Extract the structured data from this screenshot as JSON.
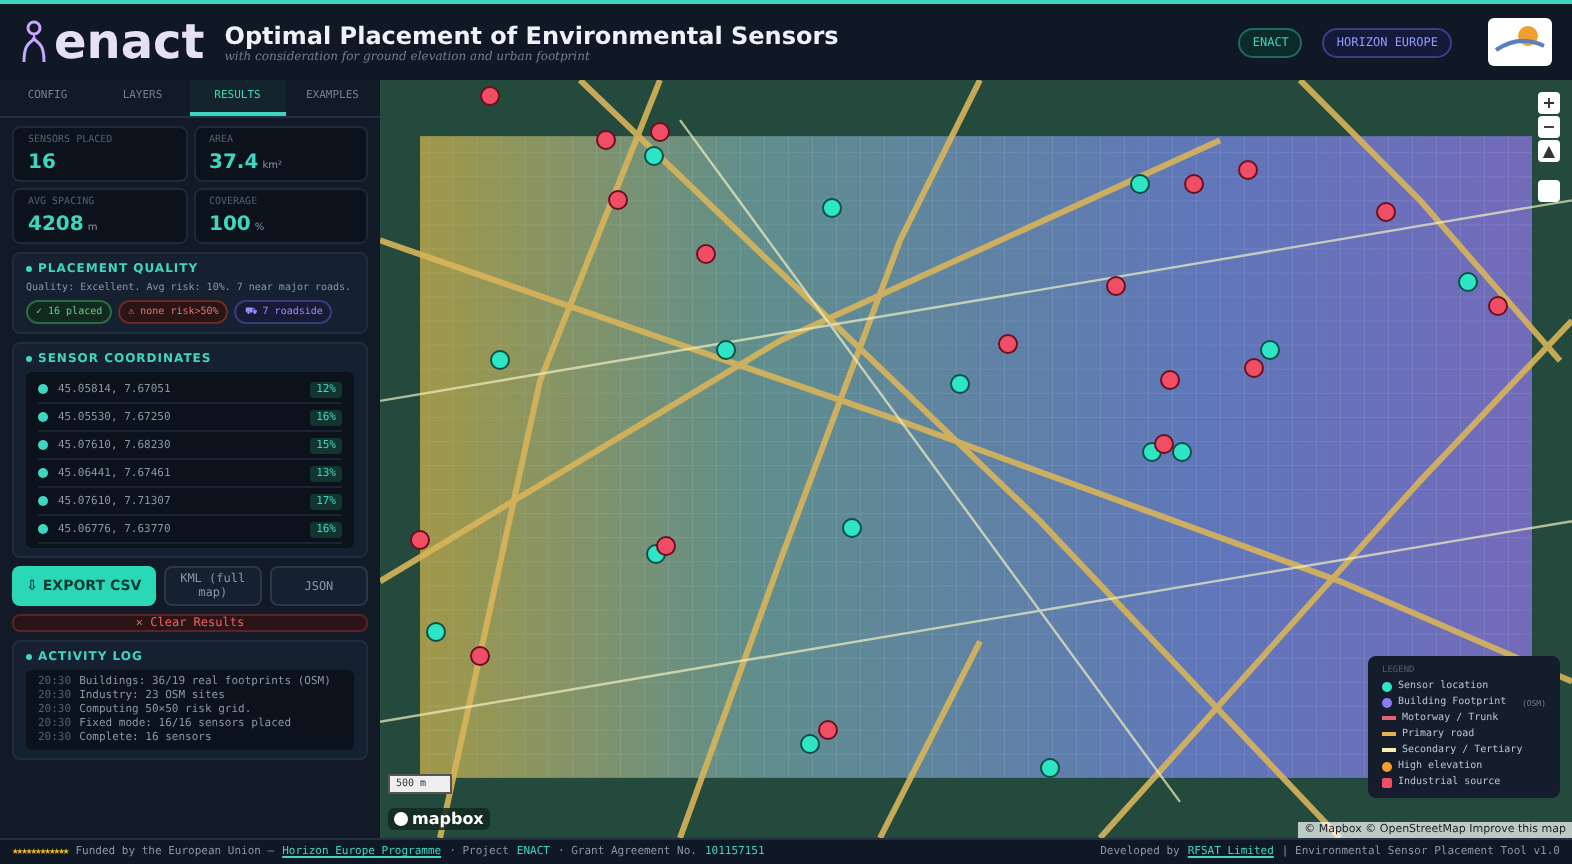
{
  "header": {
    "logo": "enact",
    "title": "Optimal Placement of Environmental Sensors",
    "subtitle": "with consideration for ground elevation and urban footprint",
    "badges": [
      "ENACT",
      "HORIZON EUROPE"
    ]
  },
  "tabs": [
    {
      "label": "CONFIG",
      "selected": false
    },
    {
      "label": "LAYERS",
      "selected": false
    },
    {
      "label": "RESULTS",
      "selected": true
    },
    {
      "label": "EXAMPLES",
      "selected": false
    }
  ],
  "stats": [
    {
      "label": "SENSORS PLACED",
      "value": "16"
    },
    {
      "label": "AREA",
      "value": "37.4",
      "unit": "km²"
    },
    {
      "label": "AVG SPACING",
      "value": "4208",
      "unit": "m"
    },
    {
      "label": "COVERAGE",
      "value": "100",
      "unit": "%"
    }
  ],
  "quality": {
    "title": "PLACEMENT QUALITY",
    "text": "Quality: Excellent. Avg risk: 10%. 7 near major roads.",
    "chips": [
      {
        "label": "✓ 16 placed",
        "kind": "good"
      },
      {
        "label": "⚠ none risk>50%",
        "kind": "warn"
      },
      {
        "label": "⛟ 7 roadside",
        "kind": "info"
      }
    ]
  },
  "coordinates": {
    "title": "SENSOR COORDINATES",
    "rows": [
      {
        "coords": "45.05814, 7.67051",
        "risk": "12%"
      },
      {
        "coords": "45.05530, 7.67250",
        "risk": "16%"
      },
      {
        "coords": "45.07610, 7.68230",
        "risk": "15%"
      },
      {
        "coords": "45.06441, 7.67461",
        "risk": "13%"
      },
      {
        "coords": "45.07610, 7.71307",
        "risk": "17%"
      },
      {
        "coords": "45.06776, 7.63770",
        "risk": "16%"
      }
    ]
  },
  "actions": [
    {
      "label": "⇩ EXPORT CSV",
      "kind": "primary"
    },
    {
      "label": "KML (full map)",
      "kind": "secondary"
    },
    {
      "label": "JSON",
      "kind": "secondary"
    },
    {
      "label": "✕ Clear Results",
      "kind": "danger"
    }
  ],
  "log": {
    "title": "ACTIVITY LOG",
    "lines": [
      {
        "time": "20:30",
        "text": "Buildings: 36/19 real footprints (OSM)"
      },
      {
        "time": "20:30",
        "text": "Industry: 23 OSM sites"
      },
      {
        "time": "20:30",
        "text": "Computing 50×50 risk grid."
      },
      {
        "time": "20:30",
        "text": "Fixed mode: 16/16 sensors placed"
      },
      {
        "time": "20:30",
        "text": "Complete: 16 sensors"
      }
    ]
  },
  "map": {
    "zoom_controls": [
      "+",
      "−",
      "▲"
    ],
    "scale": "500 m",
    "brand": "mapbox",
    "attribution": "© Mapbox © OpenStreetMap Improve this map",
    "markers": [
      {
        "kind": "sensor"
      },
      {
        "kind": "sensor"
      },
      {
        "kind": "sensor"
      },
      {
        "kind": "sensor"
      },
      {
        "kind": "sensor"
      },
      {
        "kind": "sensor"
      },
      {
        "kind": "sensor"
      },
      {
        "kind": "sensor"
      },
      {
        "kind": "sensor"
      },
      {
        "kind": "sensor"
      },
      {
        "kind": "sensor"
      },
      {
        "kind": "sensor"
      },
      {
        "kind": "sensor"
      },
      {
        "kind": "sensor"
      },
      {
        "kind": "sensor"
      },
      {
        "kind": "industrial"
      },
      {
        "kind": "industrial"
      },
      {
        "kind": "industrial"
      },
      {
        "kind": "industrial"
      },
      {
        "kind": "industrial"
      },
      {
        "kind": "industrial"
      },
      {
        "kind": "industrial"
      },
      {
        "kind": "industrial"
      },
      {
        "kind": "industrial"
      },
      {
        "kind": "industrial"
      },
      {
        "kind": "industrial"
      },
      {
        "kind": "industrial"
      },
      {
        "kind": "industrial"
      },
      {
        "kind": "industrial"
      },
      {
        "kind": "industrial"
      },
      {
        "kind": "industrial"
      },
      {
        "kind": "industrial"
      },
      {
        "kind": "industrial"
      }
    ],
    "legend": {
      "title": "LEGEND",
      "items": [
        {
          "label": "Sensor location",
          "kind": "dot",
          "color": "#2ee6c5"
        },
        {
          "label": "Building Footprint",
          "kind": "dot",
          "color": "#8b7cf0",
          "note": "(OSM)"
        },
        {
          "label": "Motorway / Trunk",
          "kind": "line",
          "color": "#e0607a"
        },
        {
          "label": "Primary road",
          "kind": "line",
          "color": "#e8b04a"
        },
        {
          "label": "Secondary / Tertiary",
          "kind": "line",
          "color": "#f0f0b0"
        },
        {
          "label": "High elevation",
          "kind": "dot",
          "color": "#f0a030"
        },
        {
          "label": "Industrial source",
          "kind": "square",
          "color": "#f04e64"
        }
      ]
    }
  },
  "footer": {
    "stars": "★★★★★★★★★★★★",
    "funded": "Funded by the European Union —",
    "programme": "Horizon Europe Programme",
    "project_label": "· Project",
    "project": "ENACT",
    "grant_label": "· Grant Agreement No.",
    "grant": "101157151",
    "dev_label": "Developed by",
    "dev": "RFSAT Limited",
    "tool": "| Environmental Sensor Placement Tool v1.0"
  }
}
